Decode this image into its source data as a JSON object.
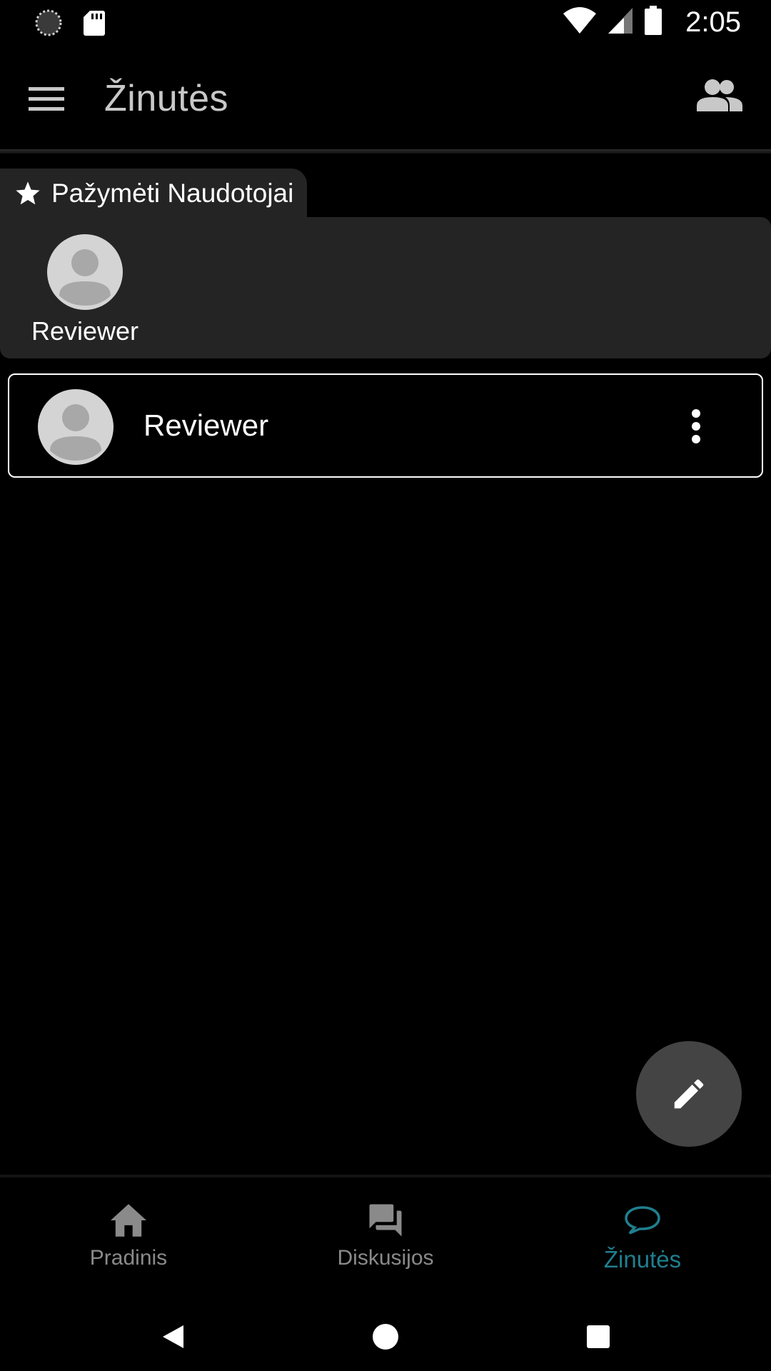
{
  "status_bar": {
    "time": "2:05",
    "icons": [
      "loading-circle-icon",
      "sd-card-icon",
      "wifi-icon",
      "cell-signal-icon",
      "battery-icon"
    ]
  },
  "app_bar": {
    "title": "Žinutės",
    "menu_icon": "hamburger-menu-icon",
    "contacts_icon": "people-icon"
  },
  "starred": {
    "tab_label": "Pažymėti Naudotojai",
    "users": [
      {
        "name": "Reviewer"
      }
    ]
  },
  "conversations": [
    {
      "name": "Reviewer"
    }
  ],
  "fab": {
    "icon": "pencil-icon"
  },
  "bottom_nav": {
    "items": [
      {
        "label": "Pradinis",
        "icon": "home-icon",
        "active": false
      },
      {
        "label": "Diskusijos",
        "icon": "forum-icon",
        "active": false
      },
      {
        "label": "Žinutės",
        "icon": "chat-bubble-icon",
        "active": true
      }
    ]
  },
  "colors": {
    "background": "#000000",
    "panel": "#242424",
    "accent": "#1f7f8f",
    "fab": "#444444",
    "inactive": "#8a8a8a"
  }
}
